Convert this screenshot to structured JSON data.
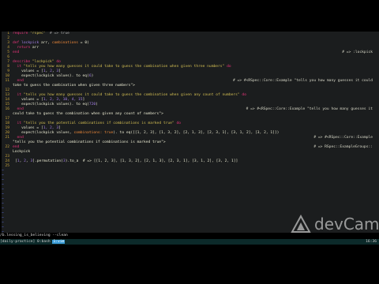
{
  "editor": {
    "lines": [
      {
        "n": "1",
        "code": [
          {
            "t": "require ",
            "c": "k"
          },
          {
            "t": "\"rspec\"",
            "c": "s"
          },
          {
            "t": "  # => true",
            "c": "c"
          }
        ]
      },
      {
        "n": "2",
        "code": []
      },
      {
        "n": "3",
        "code": [
          {
            "t": "def ",
            "c": "k"
          },
          {
            "t": "lockpick ",
            "c": "n"
          },
          {
            "t": "arr, ",
            "c": ""
          },
          {
            "t": "combinations",
            "c": "i"
          },
          {
            "t": " = 0)",
            "c": ""
          }
        ]
      },
      {
        "n": "4",
        "code": [
          {
            "t": "  return ",
            "c": "k"
          },
          {
            "t": "arr",
            "c": ""
          }
        ]
      },
      {
        "n": "5",
        "code": [
          {
            "t": "end",
            "c": "k"
          }
        ],
        "rhs": "# => :lockpick"
      },
      {
        "n": "6",
        "code": []
      },
      {
        "n": "7",
        "code": [
          {
            "t": "describe ",
            "c": "k"
          },
          {
            "t": "\"lockpick\"",
            "c": "s"
          },
          {
            "t": " do",
            "c": "k"
          }
        ]
      },
      {
        "n": "8",
        "code": [
          {
            "t": "  it ",
            "c": "k"
          },
          {
            "t": "\"tells you how many guesses it could take to guess the combination when given three numbers\"",
            "c": "s"
          },
          {
            "t": " do",
            "c": "k"
          }
        ]
      },
      {
        "n": "9",
        "code": [
          {
            "t": "    values = [",
            "c": ""
          },
          {
            "t": "1",
            "c": "n"
          },
          {
            "t": ", ",
            "c": ""
          },
          {
            "t": "2",
            "c": "n"
          },
          {
            "t": ", ",
            "c": ""
          },
          {
            "t": "3",
            "c": "n"
          },
          {
            "t": "]",
            "c": ""
          }
        ]
      },
      {
        "n": "10",
        "code": [
          {
            "t": "    expect(lockpick values). to eq(",
            "c": ""
          },
          {
            "t": "6",
            "c": "n"
          },
          {
            "t": ")",
            "c": ""
          }
        ]
      },
      {
        "n": "11",
        "code": [
          {
            "t": "  end",
            "c": "k"
          }
        ],
        "rhs": "# => #<RSpec::Core::Example \"tells you how many guesses it could"
      },
      {
        "n": "",
        "code": [
          {
            "t": "take to guess the combination when given three numbers\">",
            "c": ""
          }
        ]
      },
      {
        "n": "12",
        "code": []
      },
      {
        "n": "13",
        "code": [
          {
            "t": "  it ",
            "c": "k"
          },
          {
            "t": "\"tells you how many guesses it could take to guess the combination when given any count of numbers\"",
            "c": "s"
          },
          {
            "t": " do",
            "c": "k"
          }
        ]
      },
      {
        "n": "14",
        "code": [
          {
            "t": "    values = [",
            "c": ""
          },
          {
            "t": "1, 2, 3, 10, 4, 15",
            "c": "n"
          },
          {
            "t": "]",
            "c": ""
          }
        ]
      },
      {
        "n": "15",
        "code": [
          {
            "t": "    expect(lockpick values). to eq(",
            "c": ""
          },
          {
            "t": "720",
            "c": "n"
          },
          {
            "t": ")",
            "c": ""
          }
        ]
      },
      {
        "n": "16",
        "code": [
          {
            "t": "  end",
            "c": "k"
          }
        ],
        "rhs": "# => #<RSpec::Core::Example \"tells you how many guesses it"
      },
      {
        "n": "",
        "code": [
          {
            "t": "could take to guess the combination when given any count of numbers\">",
            "c": ""
          }
        ]
      },
      {
        "n": "17",
        "code": []
      },
      {
        "n": "18",
        "code": [
          {
            "t": "  it ",
            "c": "k"
          },
          {
            "t": "\"tells you the potential combinations if combinations is marked true\"",
            "c": "s"
          },
          {
            "t": " do",
            "c": "k"
          }
        ]
      },
      {
        "n": "19",
        "code": [
          {
            "t": "    values = [",
            "c": ""
          },
          {
            "t": "1, 2, 3",
            "c": "n"
          },
          {
            "t": "]",
            "c": ""
          }
        ]
      },
      {
        "n": "20",
        "code": [
          {
            "t": "    expect(lockpick values, ",
            "c": ""
          },
          {
            "t": "combinations: true",
            "c": "i"
          },
          {
            "t": "). to eq([[1, 2, 3], [1, 3, 2], [2, 1, 3], [2, 3, 1], [3, 1, 2], [3, 2, 1]])",
            "c": ""
          }
        ]
      },
      {
        "n": "21",
        "code": [
          {
            "t": "  end",
            "c": "k"
          }
        ],
        "rhs": "# => #<RSpec::Core::Example"
      },
      {
        "n": "",
        "code": [
          {
            "t": "\"tells you the potential combinations if combinations is marked true\">",
            "c": ""
          }
        ]
      },
      {
        "n": "22",
        "code": [
          {
            "t": "end",
            "c": "k"
          }
        ],
        "rhs": "# => RSpec::ExampleGroups::"
      },
      {
        "n": "",
        "code": [
          {
            "t": "Lockpick",
            "c": ""
          }
        ]
      },
      {
        "n": "23",
        "code": []
      },
      {
        "n": "24",
        "code": [
          {
            "t": "[",
            "c": ""
          },
          {
            "t": "1",
            "c": "n"
          },
          {
            "t": ", ",
            "c": ""
          },
          {
            "t": "2",
            "c": "n"
          },
          {
            "t": ", ",
            "c": ""
          },
          {
            "t": "3",
            "c": "n"
          },
          {
            "t": "].permutation(",
            "c": ""
          },
          {
            "t": "3",
            "c": "n"
          },
          {
            "t": ").to_a  ",
            "c": ""
          },
          {
            "t": "# => [[1, 2, 3], [1, 3, 2], [2, 1, 3], [2, 3, 1], [3, 1, 2], [3, 2, 1]]",
            "c": ""
          }
        ],
        "cursor": true
      },
      {
        "n": "25",
        "code": []
      }
    ],
    "tilde": "~",
    "tilde_count": 16
  },
  "status": {
    "file": "/b.lessing_is_believing --clean"
  },
  "cmdbar": {
    "session": "[daily-practice]",
    "inactive_window": "0:bash",
    "active_window": "1:vim",
    "clock": "16:36"
  },
  "watermark": {
    "text": "devCamp",
    "icon": "devcamp-logo-icon"
  }
}
